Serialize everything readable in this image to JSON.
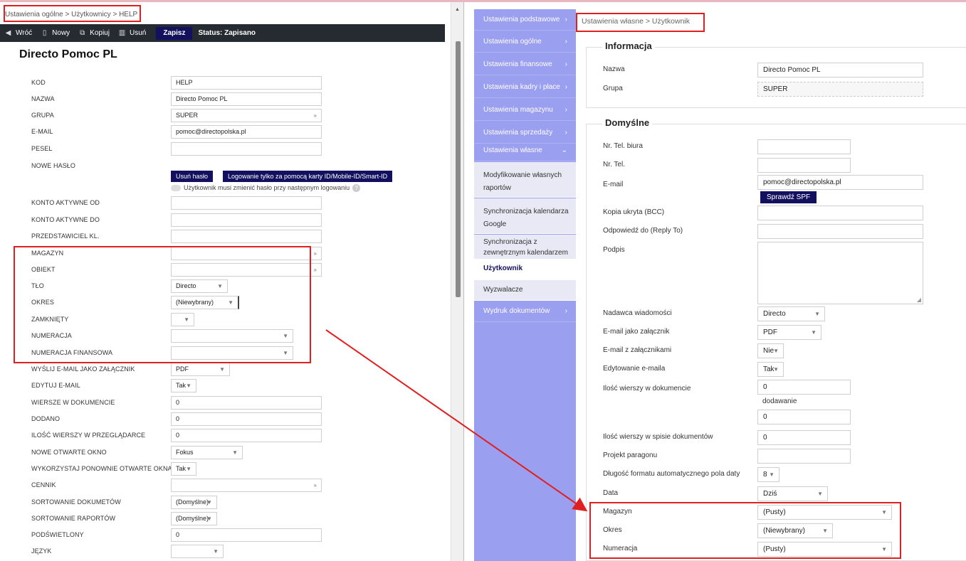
{
  "left": {
    "breadcrumb": "Ustawienia ogólne > Użytkownicy > HELP",
    "toolbar": {
      "back": "Wróć",
      "new": "Nowy",
      "copy": "Kopiuj",
      "delete": "Usuń",
      "save": "Zapisz",
      "status": "Status: Zapisano"
    },
    "title": "Directo Pomoc PL",
    "fields": {
      "kod": {
        "label": "KOD",
        "value": "HELP"
      },
      "nazwa": {
        "label": "NAZWA",
        "value": "Directo Pomoc PL"
      },
      "grupa": {
        "label": "GRUPA",
        "value": "SUPER"
      },
      "email": {
        "label": "E-MAIL",
        "value": "pomoc@directopolska.pl"
      },
      "pesel": {
        "label": "PESEL",
        "value": ""
      },
      "haslo": {
        "label": "NOWE HASŁO",
        "btn_remove": "Usuń hasło",
        "btn_card": "Logowanie tylko za pomocą karty ID/Mobile-ID/Smart-ID",
        "toggle_text": "Użytkownik musi zmienić hasło przy następnym logowaniu"
      },
      "aktywne_od": {
        "label": "KONTO AKTYWNE OD",
        "value": ""
      },
      "aktywne_do": {
        "label": "KONTO AKTYWNE DO",
        "value": ""
      },
      "przedstawiciel": {
        "label": "PRZEDSTAWICIEL KL.",
        "value": ""
      },
      "magazyn": {
        "label": "MAGAZYN",
        "value": ""
      },
      "obiekt": {
        "label": "OBIEKT",
        "value": ""
      },
      "tlo": {
        "label": "TŁO",
        "value": "Directo"
      },
      "okres": {
        "label": "OKRES",
        "value": "(Niewybrany)"
      },
      "zamkniety": {
        "label": "ZAMKNIĘTY",
        "value": ""
      },
      "numeracja": {
        "label": "NUMERACJA",
        "value": ""
      },
      "numeracja_fin": {
        "label": "NUMERACJA FINANSOWA",
        "value": ""
      },
      "wyslij": {
        "label": "WYŚLIJ E-MAIL JAKO ZAŁĄCZNIK",
        "value": "PDF"
      },
      "edytuj": {
        "label": "EDYTUJ E-MAIL",
        "value": "Tak"
      },
      "wiersze": {
        "label": "WIERSZE W DOKUMENCIE",
        "value": "0"
      },
      "dodano": {
        "label": "DODANO",
        "value": "0"
      },
      "ilosc": {
        "label": "ILOŚĆ WIERSZY W PRZEGLĄDARCE",
        "value": "0"
      },
      "nowe_okno": {
        "label": "NOWE OTWARTE OKNO",
        "value": "Fokus"
      },
      "wykorzystaj": {
        "label": "WYKORZYSTAJ PONOWNIE OTWARTE OKNA",
        "value": "Tak"
      },
      "cennik": {
        "label": "CENNIK",
        "value": ""
      },
      "sort_dok": {
        "label": "SORTOWANIE DOKUMETÓW",
        "value": "(Domyślne)"
      },
      "sort_rap": {
        "label": "SORTOWANIE RAPORTÓW",
        "value": "(Domyślne)"
      },
      "podswietlony": {
        "label": "PODŚWIETLONY",
        "value": "0"
      },
      "jezyk": {
        "label": "JĘZYK",
        "value": ""
      }
    }
  },
  "sidebar": {
    "items": [
      {
        "label": "Ustawienia podstawowe"
      },
      {
        "label": "Ustawienia ogólne"
      },
      {
        "label": "Ustawienia finansowe"
      },
      {
        "label": "Ustawienia kadry i płace"
      },
      {
        "label": "Ustawienia magazynu"
      },
      {
        "label": "Ustawienia sprzedaży"
      },
      {
        "label": "Ustawienia własne"
      }
    ],
    "subitems": [
      {
        "label": "Modyfikowanie własnych raportów"
      },
      {
        "label": "Synchronizacja kalendarza Google"
      },
      {
        "label": "Synchronizacja z zewnętrznym kalendarzem"
      },
      {
        "label": "Użytkownik"
      },
      {
        "label": "Wyzwalacze"
      }
    ],
    "last": "Wydruk dokumentów"
  },
  "right": {
    "breadcrumb": "Ustawienia własne > Użytkownik",
    "info_title": "Informacja",
    "nazwa": {
      "label": "Nazwa",
      "value": "Directo Pomoc PL"
    },
    "grupa": {
      "label": "Grupa",
      "value": "SUPER"
    },
    "domyslne_title": "Domyślne",
    "tel_biura": {
      "label": "Nr. Tel. biura",
      "value": ""
    },
    "tel": {
      "label": "Nr. Tel.",
      "value": ""
    },
    "email": {
      "label": "E-mail",
      "value": "pomoc@directopolska.pl",
      "btn": "Sprawdź SPF"
    },
    "bcc": {
      "label": "Kopia ukryta (BCC)",
      "value": ""
    },
    "reply": {
      "label": "Odpowiedź do (Reply To)",
      "value": ""
    },
    "podpis": {
      "label": "Podpis"
    },
    "nadawca": {
      "label": "Nadawca wiadomości",
      "value": "Directo"
    },
    "zalacznik": {
      "label": "E-mail jako załącznik",
      "value": "PDF"
    },
    "z_zalacznikami": {
      "label": "E-mail z załącznikami",
      "value": "Nie"
    },
    "edytowanie": {
      "label": "Edytowanie e-maila",
      "value": "Tak"
    },
    "ilosc_wierszy": {
      "label": "Ilość wierszy w dokumencie",
      "value": "0",
      "sub": "dodawanie",
      "sub_value": "0"
    },
    "ilosc_spis": {
      "label": "Ilość wierszy w spisie dokumentów",
      "value": "0"
    },
    "projekt": {
      "label": "Projekt paragonu",
      "value": ""
    },
    "dlugosc": {
      "label": "Długość formatu automatycznego pola daty",
      "value": "8"
    },
    "data": {
      "label": "Data",
      "value": "Dziś"
    },
    "magazyn": {
      "label": "Magazyn",
      "value": "(Pusty)"
    },
    "okres": {
      "label": "Okres",
      "value": "(Niewybrany)"
    },
    "numeracja": {
      "label": "Numeracja",
      "value": "(Pusty)"
    }
  },
  "colors": {
    "accent": "#13105f",
    "sidebar": "#9b9ff0",
    "highlight": "#e02020",
    "toolbar": "#262a31"
  }
}
